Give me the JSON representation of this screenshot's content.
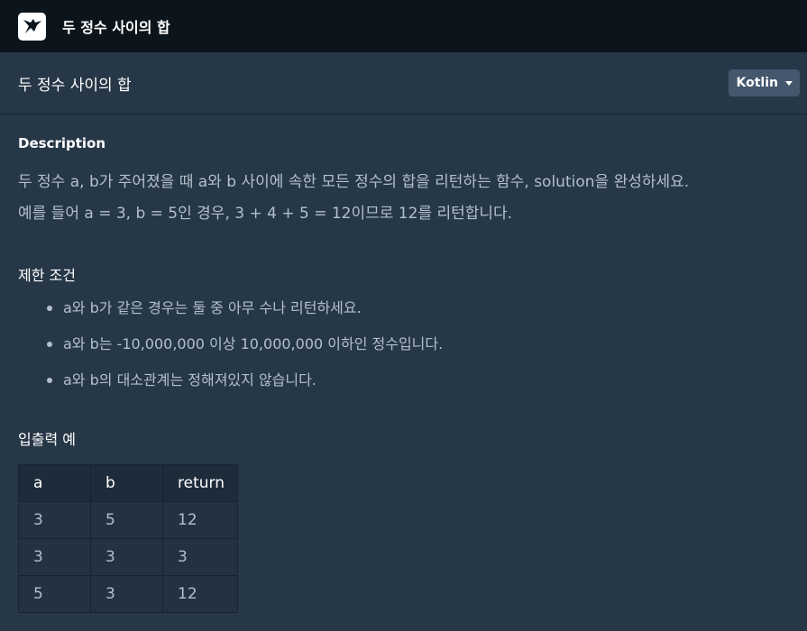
{
  "topbar": {
    "title": "두 정수 사이의 합",
    "logo_icon": "programmers-logo-icon"
  },
  "header": {
    "title": "두 정수 사이의 합",
    "language": "Kotlin"
  },
  "description": {
    "heading": "Description",
    "paragraphs": [
      "두 정수 a, b가 주어졌을 때 a와 b 사이에 속한 모든 정수의 합을 리턴하는 함수, solution을 완성하세요.",
      "예를 들어 a = 3, b = 5인 경우, 3 + 4 + 5 = 12이므로 12를 리턴합니다."
    ]
  },
  "constraints": {
    "heading": "제한 조건",
    "items": [
      "a와 b가 같은 경우는 둘 중 아무 수나 리턴하세요.",
      "a와 b는 -10,000,000 이상 10,000,000 이하인 정수입니다.",
      "a와 b의 대소관계는 정해져있지 않습니다."
    ]
  },
  "io": {
    "heading": "입출력 예",
    "columns": [
      "a",
      "b",
      "return"
    ],
    "rows": [
      [
        "3",
        "5",
        "12"
      ],
      [
        "3",
        "3",
        "3"
      ],
      [
        "5",
        "3",
        "12"
      ]
    ]
  },
  "colors": {
    "background": "#263747",
    "topbar": "#0c151c",
    "button": "#44576c"
  }
}
